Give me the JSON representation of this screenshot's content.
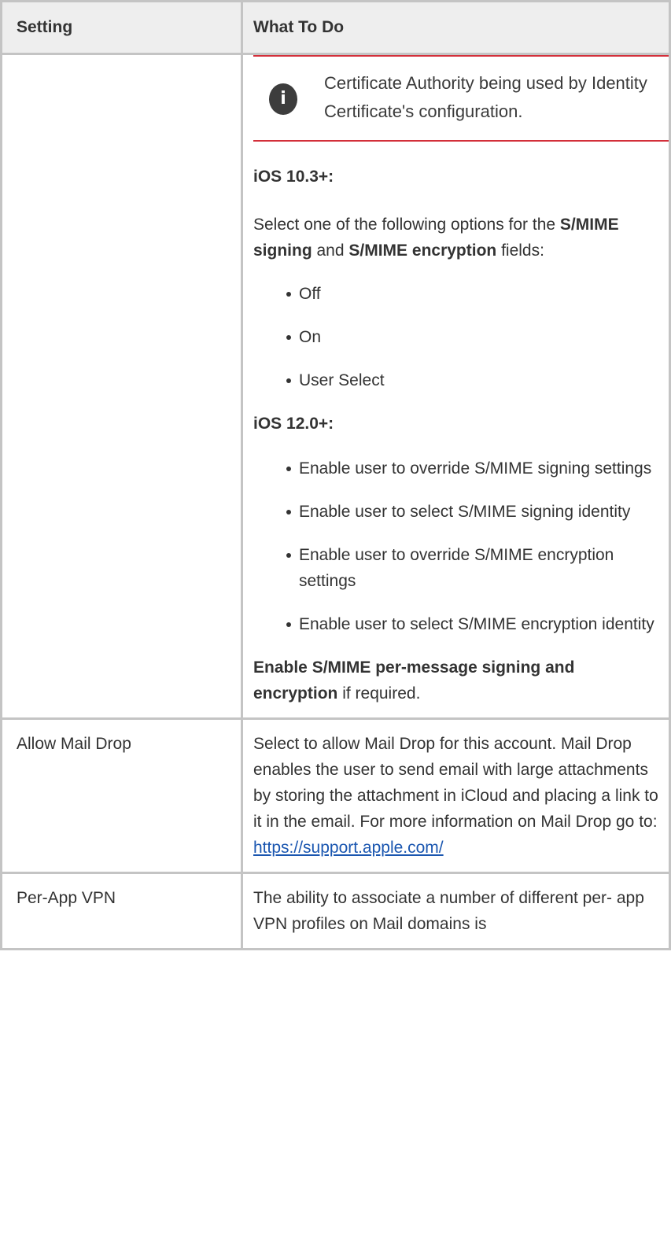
{
  "table": {
    "headers": {
      "setting": "Setting",
      "what": "What To Do"
    },
    "row1": {
      "setting": "",
      "note_icon": "info-icon",
      "note_text": "Certificate Authority being used by Identity Certificate's configuration.",
      "ios103_heading": "iOS 10.3+:",
      "select_prefix": "Select one of the following options for the ",
      "signing_field": "S/MIME signing",
      "and_word": " and ",
      "encryption_field": "S/MIME encryption",
      "fields_suffix": " fields:",
      "options": [
        "Off",
        "On",
        "User Select"
      ],
      "ios12_heading": "iOS 12.0+:",
      "ios12_options": [
        "Enable user to override S/MIME signing settings",
        "Enable user to select S/MIME signing identity",
        "Enable user to override S/MIME encryption settings",
        "Enable user to select S/MIME encryption identity"
      ],
      "enable_bold": "Enable S/MIME per-message signing and encryption",
      "enable_suffix": " if required."
    },
    "row2": {
      "setting": "Allow Mail Drop",
      "description": "Select to allow Mail Drop for this account. Mail Drop enables the user to send email with large attachments by storing the attachment in iCloud and placing a link to it in the email. For more information on Mail Drop go to: ",
      "link": "https://support.apple.com/"
    },
    "row3": {
      "setting": "Per-App VPN",
      "description": "The ability to associate a number of different per- app VPN profiles on Mail domains is"
    }
  }
}
